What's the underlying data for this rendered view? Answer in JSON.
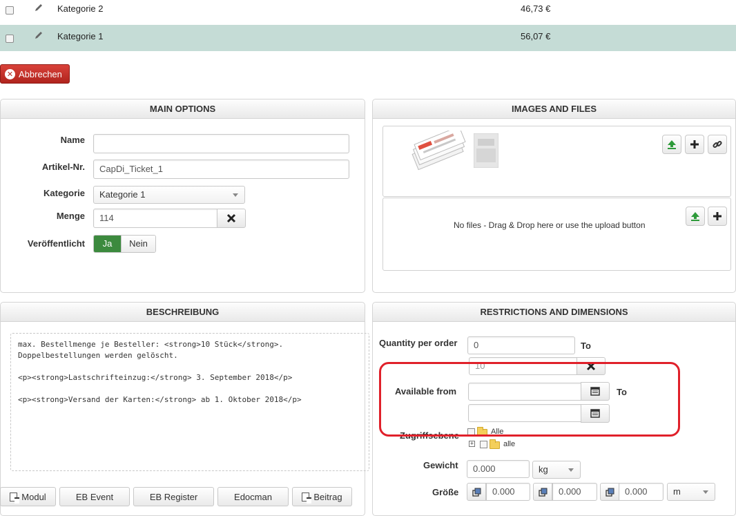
{
  "categories_table": {
    "rows": [
      {
        "name": "Kategorie 2",
        "price": "46,73 €",
        "selected": false
      },
      {
        "name": "Kategorie 1",
        "price": "56,07 €",
        "selected": true
      }
    ]
  },
  "cancel_button": {
    "label": "Abbrechen"
  },
  "main_options": {
    "title": "MAIN OPTIONS",
    "name_label": "Name",
    "name_value": "",
    "sku_label": "Artikel-Nr.",
    "sku_value": "CapDi_Ticket_1",
    "category_label": "Kategorie",
    "category_value": "Kategorie 1",
    "quantity_label": "Menge",
    "quantity_value": "114",
    "published_label": "Veröffentlicht",
    "published_yes": "Ja",
    "published_no": "Nein"
  },
  "images_files": {
    "title": "IMAGES AND FILES",
    "no_files_text": "No files - Drag & Drop here or use the upload button"
  },
  "description": {
    "title": "BESCHREIBUNG",
    "content": "max. Bestellmenge je Besteller: <strong>10 Stück</strong>.\nDoppelbestellungen werden gelöscht.\n\n<p><strong>Lastschrifteinzug:</strong> 3. September 2018</p>\n\n<p><strong>Versand der Karten:</strong> ab 1. Oktober 2018</p>"
  },
  "editor_buttons": [
    {
      "label": "Modul"
    },
    {
      "label": "EB Event"
    },
    {
      "label": "EB Register"
    },
    {
      "label": "Edocman"
    },
    {
      "label": "Beitrag"
    }
  ],
  "restrictions": {
    "title": "RESTRICTIONS AND DIMENSIONS",
    "qty_label": "Quantity per order",
    "qty_min": "0",
    "qty_to": "To",
    "qty_max": "10",
    "available_label": "Available from",
    "available_from": "",
    "available_to_label": "To",
    "available_to": "",
    "access_label": "Zugriffsebene",
    "access_tree": [
      {
        "label": "Alle"
      },
      {
        "label": "alle"
      }
    ],
    "weight_label": "Gewicht",
    "weight_value": "0.000",
    "weight_unit": "kg",
    "size_label": "Größe",
    "size_length": "0.000",
    "size_width": "0.000",
    "size_height": "0.000",
    "size_unit": "m"
  },
  "colors": {
    "selected_row": "#c5dcd6",
    "cancel_red": "#b72a22",
    "toggle_green": "#3c8a3e",
    "highlight_red": "#e0202a"
  }
}
